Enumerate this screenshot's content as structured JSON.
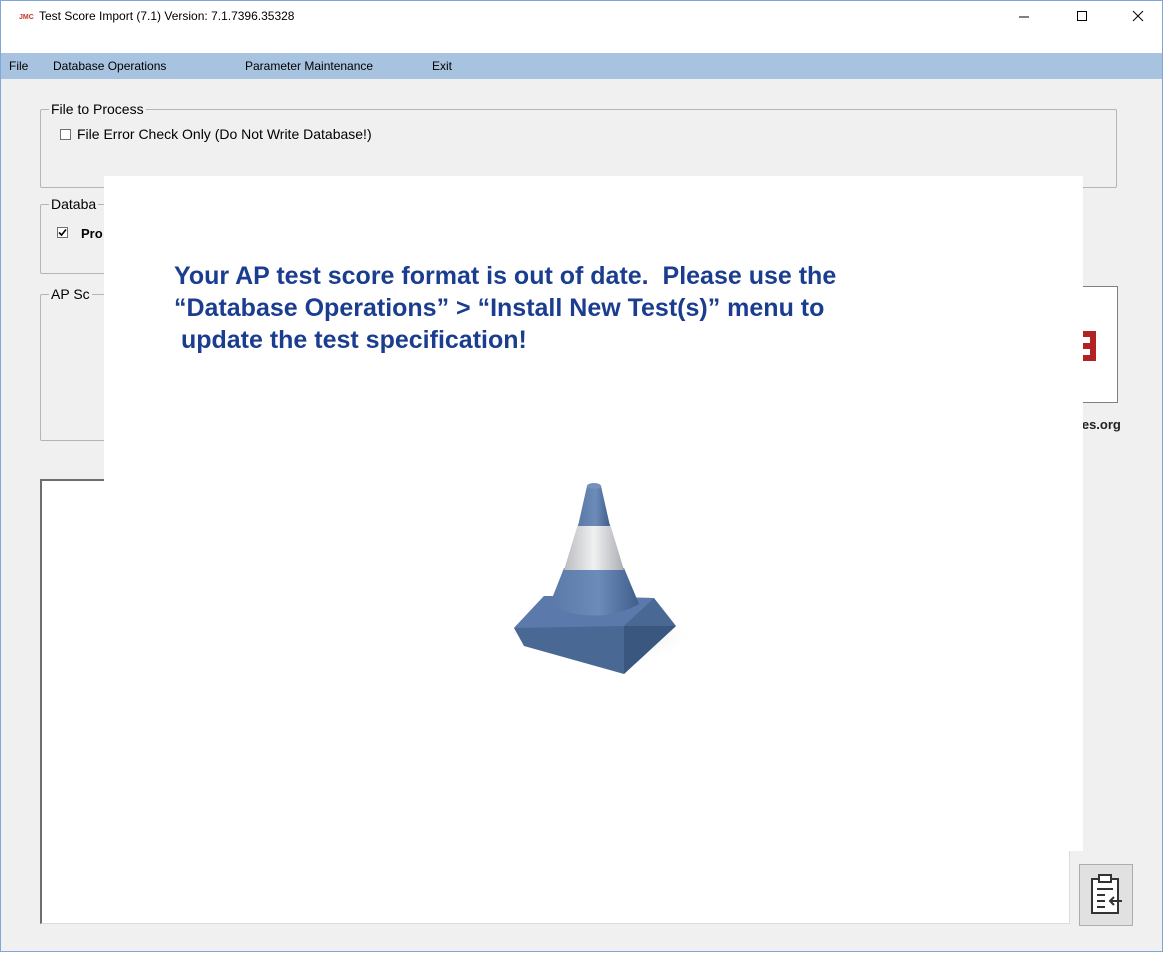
{
  "window": {
    "app_icon_text": "JMC",
    "title": "Test Score Import (7.1) Version: 7.1.7396.35328",
    "controls": {
      "minimize": "—",
      "maximize": "☐",
      "close": "✕"
    }
  },
  "menubar": {
    "items": [
      {
        "label": "File"
      },
      {
        "label": "Database Operations"
      },
      {
        "label": "Parameter Maintenance"
      },
      {
        "label": "Exit"
      }
    ]
  },
  "file_to_process": {
    "legend": "File to Process",
    "error_check_label": "File Error Check Only (Do Not Write Database!)",
    "error_check_checked": false
  },
  "database_group": {
    "legend_visible": "Databa",
    "option_label_visible": "Pro",
    "option_checked": true
  },
  "ap_scores_group": {
    "legend_visible": "AP Sc"
  },
  "logo": {
    "url_visible": "ices.org",
    "glyph_color": "#b22222"
  },
  "overlay": {
    "message_lines": [
      "Your AP test score format is out of date.  Please use the",
      "“Database Operations” > “Install New Test(s)” menu to",
      " update the test specification!"
    ],
    "message_color": "#1b3d8f",
    "image_icon": "traffic-cone-icon"
  },
  "import_button": {
    "icon": "clipboard-import-icon"
  }
}
